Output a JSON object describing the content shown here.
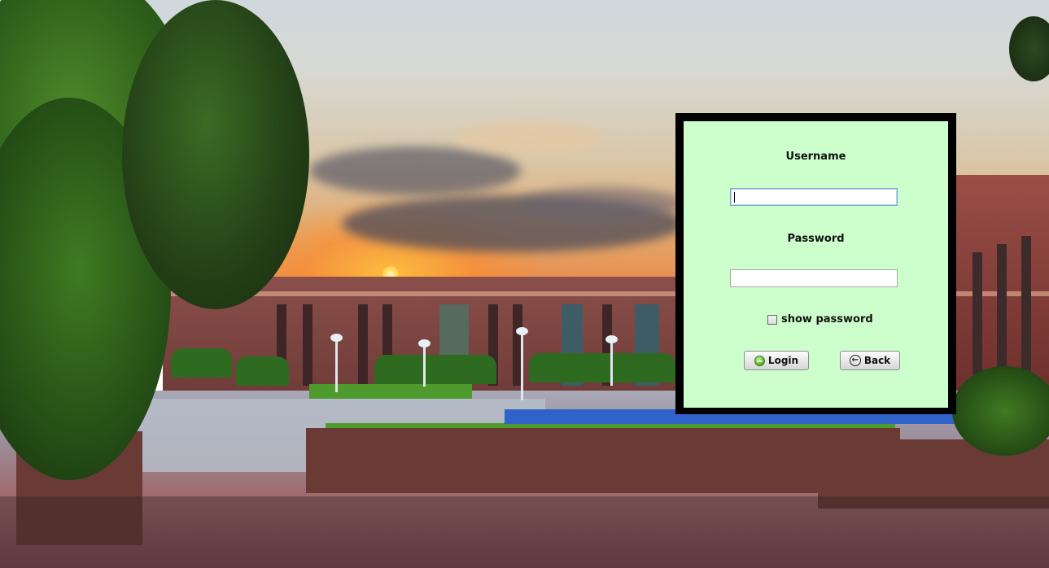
{
  "login": {
    "username_label": "Username",
    "username_value": "",
    "password_label": "Password",
    "password_value": "",
    "show_password_label": "show password",
    "show_password_checked": false,
    "login_button": "Login",
    "back_button": "Back"
  },
  "icons": {
    "login": "green-orb-icon",
    "back": "circle-arrow-left-icon"
  },
  "colors": {
    "panel_background": "#ccffcc",
    "frame_border": "#000000"
  }
}
